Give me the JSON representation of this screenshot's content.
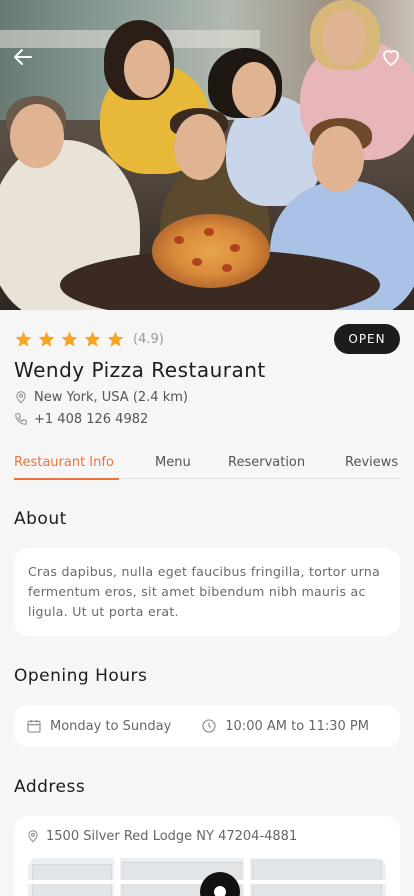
{
  "hero": {
    "back_icon": "arrow-left-icon",
    "favorite_icon": "heart-icon"
  },
  "restaurant": {
    "rating_text": "(4.9)",
    "stars": 5,
    "status": "OPEN",
    "name": "Wendy Pizza Restaurant",
    "location": "New York, USA (2.4 km)",
    "phone": "+1 408 126 4982"
  },
  "tabs": [
    {
      "label": "Restaurant Info",
      "active": true
    },
    {
      "label": "Menu",
      "active": false
    },
    {
      "label": "Reservation",
      "active": false
    },
    {
      "label": "Reviews",
      "active": false
    }
  ],
  "about": {
    "heading": "About",
    "text": "Cras dapibus, nulla eget faucibus fringilla, tortor urna fermentum eros, sit amet bibendum nibh mauris ac ligula. Ut ut porta erat."
  },
  "hours": {
    "heading": "Opening Hours",
    "days": "Monday to Sunday",
    "time": "10:00 AM to 11:30 PM"
  },
  "address": {
    "heading": "Address",
    "text": "1500 Silver Red Lodge NY 47204-4881"
  },
  "colors": {
    "accent": "#e8753d",
    "star": "#f5a623",
    "badge": "#1c1c1c"
  }
}
